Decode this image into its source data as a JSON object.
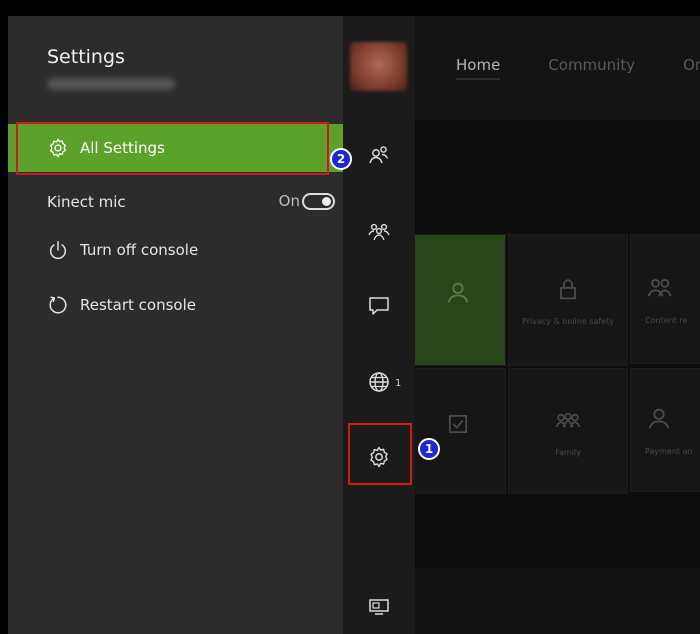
{
  "guide": {
    "title": "Settings",
    "menu": [
      {
        "id": "all-settings",
        "label": "All Settings",
        "icon": "gear-icon",
        "selected": true
      },
      {
        "id": "kinect-mic",
        "label": "Kinect mic",
        "value": "On",
        "toggle_on": true
      },
      {
        "id": "turn-off",
        "label": "Turn off console",
        "icon": "power-icon"
      },
      {
        "id": "restart",
        "label": "Restart console",
        "icon": "restart-icon"
      }
    ]
  },
  "strip": {
    "icons": [
      "avatar",
      "friends-icon",
      "party-icon",
      "chat-icon",
      "globe-icon",
      "gear-icon",
      "tv-icon"
    ],
    "globe_count": "1"
  },
  "home": {
    "tabs": [
      "Home",
      "Community",
      "Or"
    ],
    "tiles": [
      "Privacy & online safety",
      "Family",
      "Content re",
      "Payment an"
    ]
  },
  "annotations": [
    {
      "step": "1",
      "target": "gear-icon"
    },
    {
      "step": "2",
      "target": "all-settings"
    }
  ],
  "colors": {
    "accent": "#5ca12a",
    "highlight": "#d11a1a",
    "badge": "#1c28d8"
  }
}
